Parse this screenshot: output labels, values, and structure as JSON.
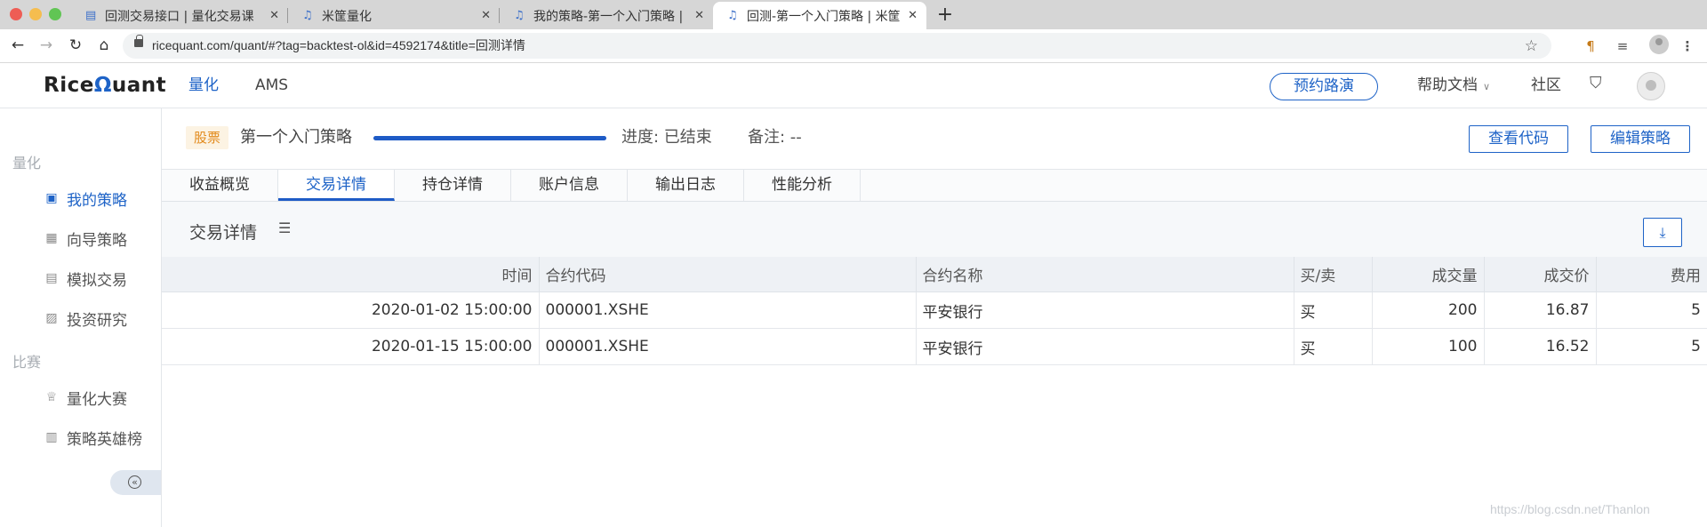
{
  "browser": {
    "tabs": [
      {
        "title": "回测交易接口 | 量化交易课",
        "icon": "book-icon"
      },
      {
        "title": "米筐量化",
        "icon": "bell-icon"
      },
      {
        "title": "我的策略-第一个入门策略 |",
        "icon": "bell-icon"
      },
      {
        "title": "回测-第一个入门策略 | 米筐",
        "icon": "bell-icon",
        "active": true
      }
    ],
    "url": "ricequant.com/quant/#?tag=backtest-ol&id=4592174&title=回测详情"
  },
  "header": {
    "logo": {
      "before": "Rice",
      "mark": "Ω",
      "after": "uant"
    },
    "nav": [
      "量化",
      "AMS"
    ],
    "roadshow_btn": "预约路演",
    "help": "帮助文档",
    "community": "社区"
  },
  "sidebar": {
    "sections": [
      {
        "title": "量化",
        "items": [
          {
            "label": "我的策略",
            "icon": "strategy-chart-icon",
            "active": true
          },
          {
            "label": "向导策略",
            "icon": "wizard-icon"
          },
          {
            "label": "模拟交易",
            "icon": "simulation-icon"
          },
          {
            "label": "投资研究",
            "icon": "research-icon"
          }
        ]
      },
      {
        "title": "比赛",
        "items": [
          {
            "label": "量化大赛",
            "icon": "trophy-icon"
          },
          {
            "label": "策略英雄榜",
            "icon": "leaderboard-icon"
          }
        ]
      }
    ]
  },
  "strategy": {
    "badge": "股票",
    "name": "第一个入门策略",
    "progress": 1.0,
    "progress_text": "进度: 已结束",
    "note": "备注: --",
    "view_code": "查看代码",
    "edit_strategy": "编辑策略"
  },
  "tabs": [
    "收益概览",
    "交易详情",
    "持仓详情",
    "账户信息",
    "输出日志",
    "性能分析"
  ],
  "active_tab": 1,
  "section_title": "交易详情",
  "table": {
    "columns": [
      "时间",
      "合约代码",
      "合约名称",
      "买/卖",
      "成交量",
      "成交价",
      "费用"
    ],
    "rows": [
      [
        "2020-01-02 15:00:00",
        "000001.XSHE",
        "平安银行",
        "买",
        "200",
        "16.87",
        "5"
      ],
      [
        "2020-01-15 15:00:00",
        "000001.XSHE",
        "平安银行",
        "买",
        "100",
        "16.52",
        "5"
      ]
    ]
  },
  "watermark": "https://blog.csdn.net/Thanlon",
  "colors": {
    "brand": "#1e63c7",
    "badge_bg": "#fcf3e3",
    "badge_text": "#e28a1c",
    "buy": "#3b7ddd"
  }
}
